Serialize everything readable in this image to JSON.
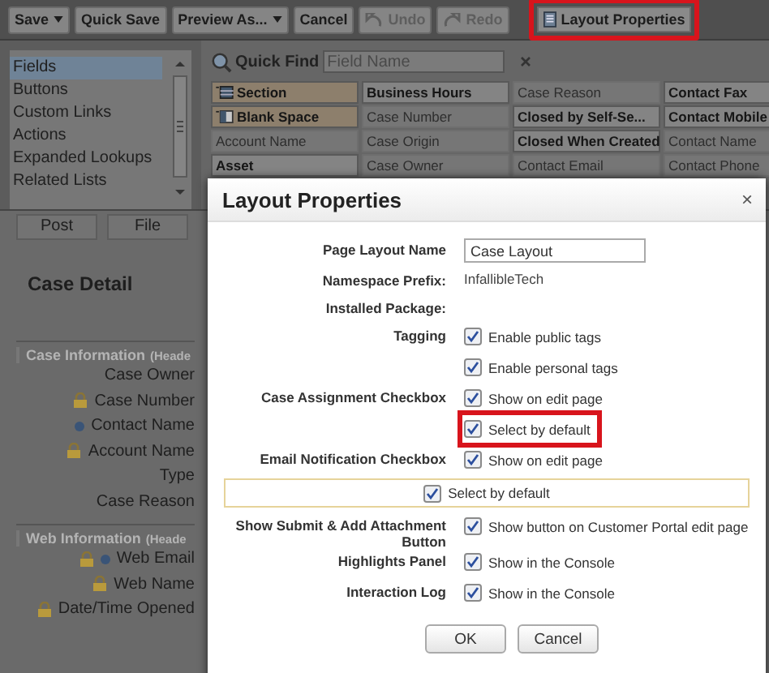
{
  "toolbar": [
    {
      "label": "Save",
      "dropdown": true,
      "disabled": false,
      "kind": "plain",
      "highlighted": false
    },
    {
      "label": "Quick Save",
      "dropdown": false,
      "disabled": false,
      "kind": "plain",
      "highlighted": false
    },
    {
      "label": "Preview As...",
      "dropdown": true,
      "disabled": false,
      "kind": "plain",
      "highlighted": false
    },
    {
      "label": "Cancel",
      "dropdown": false,
      "disabled": false,
      "kind": "plain",
      "highlighted": false
    },
    {
      "label": "Undo",
      "dropdown": false,
      "disabled": true,
      "kind": "undo",
      "highlighted": false
    },
    {
      "label": "Redo",
      "dropdown": false,
      "disabled": true,
      "kind": "redo",
      "highlighted": false
    },
    {
      "label": "Layout Properties",
      "dropdown": false,
      "disabled": false,
      "kind": "properties",
      "highlighted": true
    }
  ],
  "palette": {
    "categories": [
      {
        "label": "Fields",
        "selected": true
      },
      {
        "label": "Buttons",
        "selected": false
      },
      {
        "label": "Custom Links",
        "selected": false
      },
      {
        "label": "Actions",
        "selected": false
      },
      {
        "label": "Expanded Lookups",
        "selected": false
      },
      {
        "label": "Related Lists",
        "selected": false
      }
    ],
    "quick_find": {
      "label": "Quick Find",
      "placeholder": "Field Name"
    },
    "fields": [
      {
        "label": "Section",
        "kind": "section",
        "used": false
      },
      {
        "label": "Business Hours",
        "kind": "field",
        "used": false
      },
      {
        "label": "Case Reason",
        "kind": "field",
        "used": true
      },
      {
        "label": "Contact Fax",
        "kind": "field",
        "used": false
      },
      {
        "label": "Blank Space",
        "kind": "blank",
        "used": false
      },
      {
        "label": "Case Number",
        "kind": "field",
        "used": true
      },
      {
        "label": "Closed by Self-Se...",
        "kind": "field",
        "used": false
      },
      {
        "label": "Contact Mobile",
        "kind": "field",
        "used": false
      },
      {
        "label": "Account Name",
        "kind": "field",
        "used": true
      },
      {
        "label": "Case Origin",
        "kind": "field",
        "used": true
      },
      {
        "label": "Closed When Created",
        "kind": "field",
        "used": false
      },
      {
        "label": "Contact Name",
        "kind": "field",
        "used": true
      },
      {
        "label": "Asset",
        "kind": "field",
        "used": false
      },
      {
        "label": "Case Owner",
        "kind": "field",
        "used": true
      },
      {
        "label": "Contact Email",
        "kind": "field",
        "used": true
      },
      {
        "label": "Contact Phone",
        "kind": "field",
        "used": true
      }
    ]
  },
  "feed_tabs": [
    "Post",
    "File"
  ],
  "detail": {
    "title": "Case Detail",
    "sections": [
      {
        "title": "Case Information",
        "note": "(Heade",
        "fields": [
          {
            "label": "Case Owner",
            "locked": false,
            "required": false
          },
          {
            "label": "Case Number",
            "locked": true,
            "required": false
          },
          {
            "label": "Contact Name",
            "locked": false,
            "required": true
          },
          {
            "label": "Account Name",
            "locked": true,
            "required": false
          },
          {
            "label": "Type",
            "locked": false,
            "required": false
          },
          {
            "label": "Case Reason",
            "locked": false,
            "required": false
          }
        ]
      },
      {
        "title": "Web Information",
        "note": "(Heade",
        "fields": [
          {
            "label": "Web Email",
            "locked": true,
            "required": true
          },
          {
            "label": "Web Name",
            "locked": true,
            "required": false
          },
          {
            "label": "Date/Time Opened",
            "locked": true,
            "required": false
          }
        ]
      }
    ]
  },
  "dialog": {
    "title": "Layout Properties",
    "close": "×",
    "rows": [
      {
        "label": "Page Layout Name",
        "kind": "input",
        "value": "Case Layout"
      },
      {
        "label": "Namespace Prefix:",
        "kind": "text",
        "value": "InfallibleTech"
      },
      {
        "label": "Installed Package:",
        "kind": "text"
      },
      {
        "label": "Tagging",
        "kind": "checks",
        "options": [
          {
            "text": "Enable public tags",
            "checked": true,
            "highlighted": false
          },
          {
            "text": "Enable personal tags",
            "checked": true,
            "highlighted": false
          }
        ]
      },
      {
        "label": "Case Assignment Checkbox",
        "kind": "checks",
        "options": [
          {
            "text": "Show on edit page",
            "checked": true,
            "highlighted": false
          },
          {
            "text": "Select by default",
            "checked": true,
            "highlighted": true
          }
        ]
      },
      {
        "label": "Email Notification Checkbox",
        "kind": "checks",
        "options": [
          {
            "text": "Show on edit page",
            "checked": true,
            "highlighted": false
          }
        ]
      },
      {
        "kind": "banner",
        "options": [
          {
            "text": "Select by default",
            "checked": true,
            "highlighted": false
          }
        ]
      },
      {
        "label": "Show Submit & Add Attachment Button",
        "kind": "checks",
        "options": [
          {
            "text": "Show button on Customer Portal edit page",
            "checked": true,
            "highlighted": false
          }
        ]
      },
      {
        "label": "Highlights Panel",
        "kind": "checks",
        "options": [
          {
            "text": "Show in the Console",
            "checked": true,
            "highlighted": false
          }
        ]
      },
      {
        "label": "Interaction Log",
        "kind": "checks",
        "options": [
          {
            "text": "Show in the Console",
            "checked": true,
            "highlighted": false
          }
        ]
      }
    ],
    "buttons": [
      "OK",
      "Cancel"
    ]
  }
}
